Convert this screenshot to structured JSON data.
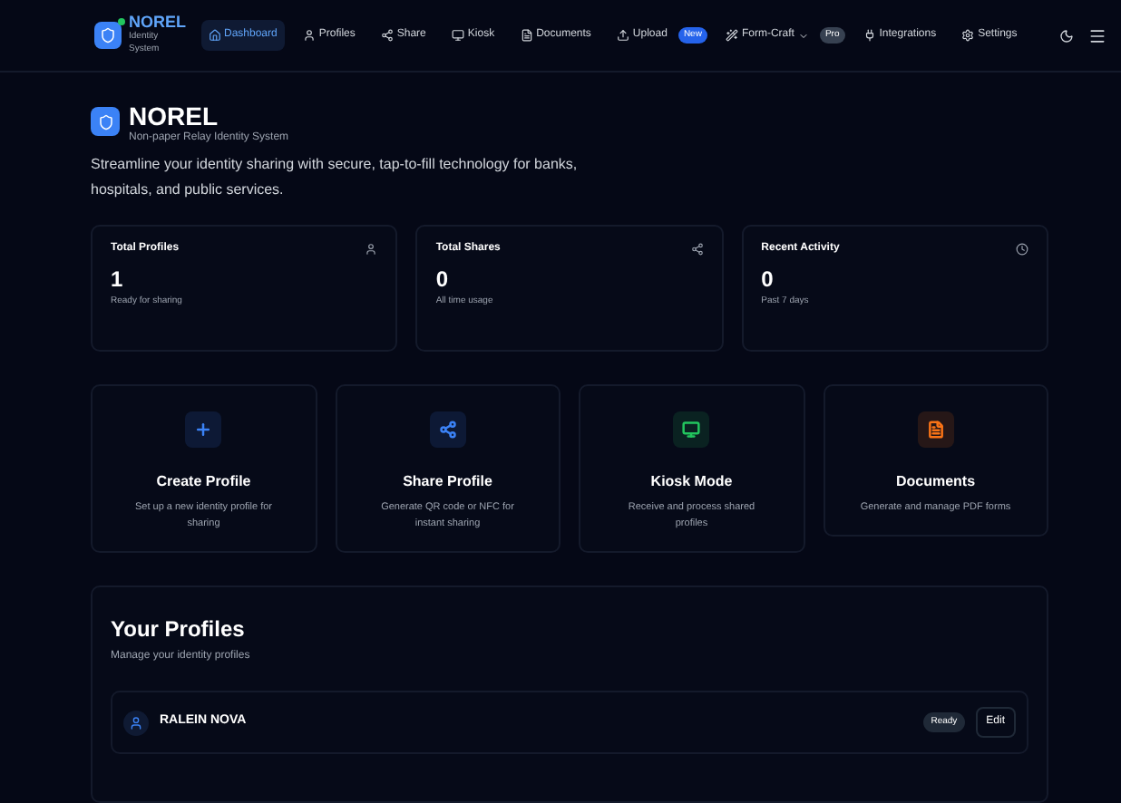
{
  "brand": {
    "name": "NOREL",
    "subtitle_lines": [
      "Identity",
      "System"
    ],
    "online": true
  },
  "nav": [
    {
      "label": "Dashboard",
      "selected": true
    },
    {
      "label": "Profiles",
      "selected": false
    },
    {
      "label": "Share",
      "selected": false
    },
    {
      "label": "Kiosk",
      "selected": false
    },
    {
      "label": "Documents",
      "selected": false
    },
    {
      "label": "Upload",
      "selected": false,
      "badge": {
        "text": "New",
        "kind": "new"
      }
    },
    {
      "label": "Form-Craft",
      "selected": false,
      "dropdown": true,
      "badge": {
        "text": "Pro",
        "kind": "pro"
      }
    },
    {
      "label": "Integrations",
      "selected": false
    },
    {
      "label": "Settings",
      "selected": false
    }
  ],
  "hero": {
    "title": "NOREL",
    "subtitle": "Non-paper Relay Identity System",
    "description": "Streamline your identity sharing with secure, tap-to-fill technology for banks, hospitals, and public services."
  },
  "stats": [
    {
      "label": "Total Profiles",
      "value": "1",
      "caption": "Ready for sharing"
    },
    {
      "label": "Total Shares",
      "value": "0",
      "caption": "All time usage"
    },
    {
      "label": "Recent Activity",
      "value": "0",
      "caption": "Past 7 days"
    }
  ],
  "actions": [
    {
      "title": "Create Profile",
      "description": "Set up a new identity profile for sharing",
      "color": "#3b82f6"
    },
    {
      "title": "Share Profile",
      "description": "Generate QR code or NFC for instant sharing",
      "color": "#3b82f6"
    },
    {
      "title": "Kiosk Mode",
      "description": "Receive and process shared profiles",
      "color": "#22c55e"
    },
    {
      "title": "Documents",
      "description": "Generate and manage PDF forms",
      "color": "#f97316"
    }
  ],
  "profiles": {
    "title": "Your Profiles",
    "subtitle": "Manage your identity profiles",
    "items": [
      {
        "name": "RALEIN NOVA",
        "status": "Ready",
        "action": "Edit"
      }
    ]
  }
}
